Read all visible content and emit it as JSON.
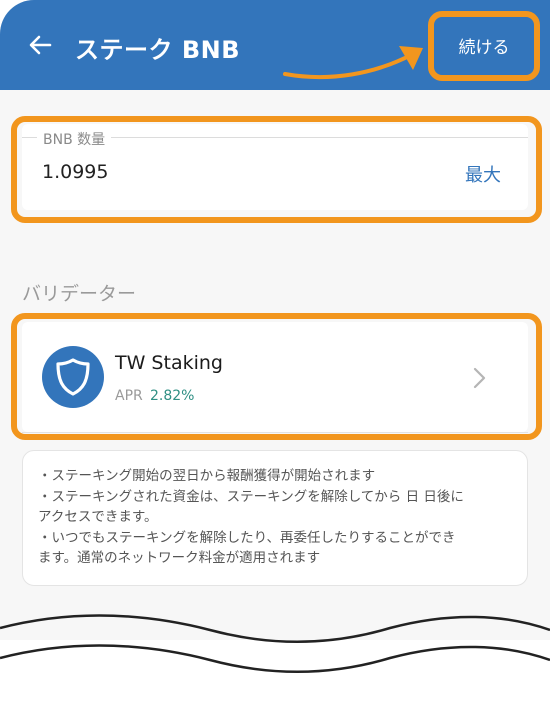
{
  "header": {
    "title": "ステーク BNB",
    "continue_label": "続ける",
    "back_icon": "arrow-left-icon"
  },
  "amount": {
    "legend": "BNB 数量",
    "value": "1.0995",
    "max_label": "最大"
  },
  "validators": {
    "section_title": "バリデーター",
    "selected": {
      "name": "TW Staking",
      "apr_label": "APR",
      "apr_value": "2.82%",
      "icon": "shield-icon"
    }
  },
  "info": {
    "lines": [
      "・ステーキング開始の翌日から報酬獲得が開始されます",
      "・ステーキングされた資金は、ステーキングを解除してから 日 日後に",
      "アクセスできます。",
      "・いつでもステーキングを解除したり、再委任したりすることができ",
      "ます。通常のネットワーク料金が適用されます"
    ]
  },
  "colors": {
    "brand_blue": "#3375bb",
    "highlight_orange": "#f2961e",
    "apr_green": "#2f8f84"
  }
}
